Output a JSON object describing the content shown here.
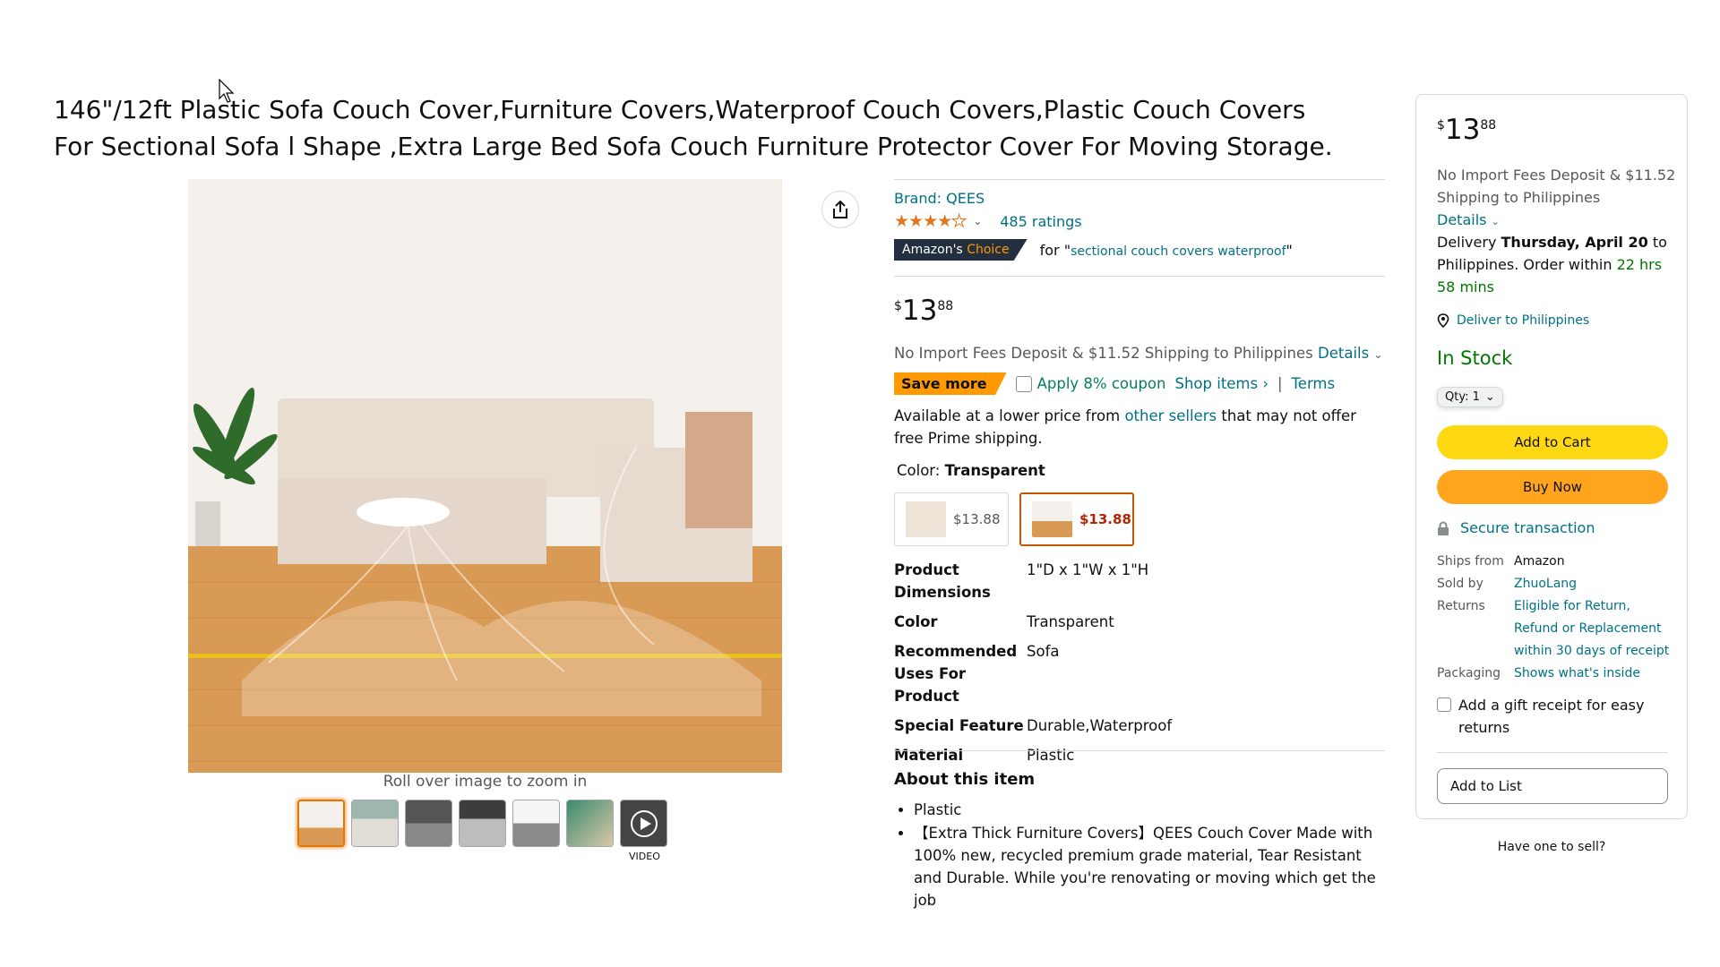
{
  "title": "146\"/12ft Plastic Sofa Couch Cover,Furniture Covers,Waterproof Couch Covers,Plastic Couch Covers For Sectional Sofa l Shape ,Extra Large Bed Sofa Couch Furniture Protector Cover For Moving Storage.",
  "gallery": {
    "zoom_hint": "Roll over image to zoom in",
    "video_label": "VIDEO",
    "thumb_count": 7
  },
  "brand": "Brand: QEES",
  "rating": {
    "stars": 4,
    "count_text": "485 ratings",
    "star_color": "#de7921"
  },
  "choice": {
    "badge_a": "Amazon's",
    "badge_b": "Choice",
    "for_text": "for \"",
    "query": "sectional couch covers waterproof",
    "close_quote": "\""
  },
  "price": {
    "symbol": "$",
    "whole": "13",
    "fraction": "88"
  },
  "shipping": {
    "text": "No Import Fees Deposit & $11.52 Shipping to Philippines",
    "details": "Details"
  },
  "coupon": {
    "badge": "Save more",
    "apply": "Apply 8% coupon",
    "shop": "Shop items ›",
    "sep": "|",
    "terms": "Terms"
  },
  "lower_price": {
    "prefix": "Available at a lower price from",
    "link": "other sellers",
    "suffix": "that may not offer free Prime shipping."
  },
  "color": {
    "label": "Color:",
    "value": "Transparent"
  },
  "swatches": [
    {
      "price": "$13.88"
    },
    {
      "price": "$13.88"
    }
  ],
  "specs": [
    {
      "key": "Product Dimensions",
      "value": "1\"D x 1\"W x 1\"H"
    },
    {
      "key": "Color",
      "value": "Transparent"
    },
    {
      "key": "Recommended Uses For Product",
      "value": "Sofa"
    },
    {
      "key": "Special Feature",
      "value": "Durable,Waterproof"
    },
    {
      "key": "Material",
      "value": "Plastic"
    }
  ],
  "about": {
    "title": "About this item",
    "items": [
      "Plastic",
      "【Extra Thick Furniture Covers】QEES Couch Cover Made with 100% new, recycled premium grade material, Tear Resistant and Durable. While you're renovating or moving which get the job"
    ]
  },
  "buybox": {
    "price": {
      "symbol": "$",
      "whole": "13",
      "fraction": "88"
    },
    "shipping": "No Import Fees Deposit & $11.52 Shipping to Philippines",
    "details": "Details",
    "delivery_prefix": "Delivery",
    "delivery_date": "Thursday, April 20",
    "delivery_suffix": "to Philippines. Order within",
    "countdown": "22 hrs 58 mins",
    "deliver_to": "Deliver to Philippines",
    "stock": "In Stock",
    "qty": "Qty: 1",
    "add_to_cart": "Add to Cart",
    "buy_now": "Buy Now",
    "secure": "Secure transaction",
    "meta": [
      {
        "key": "Ships from",
        "value": "Amazon",
        "link": false
      },
      {
        "key": "Sold by",
        "value": "ZhuoLang",
        "link": true
      },
      {
        "key": "Returns",
        "value": "Eligible for Return, Refund or Replacement within 30 days of receipt",
        "link": true
      },
      {
        "key": "Packaging",
        "value": "Shows what's inside",
        "link": true
      }
    ],
    "gift": "Add a gift receipt for easy returns",
    "add_to_list": "Add to List",
    "have_one": "Have one to sell?"
  }
}
